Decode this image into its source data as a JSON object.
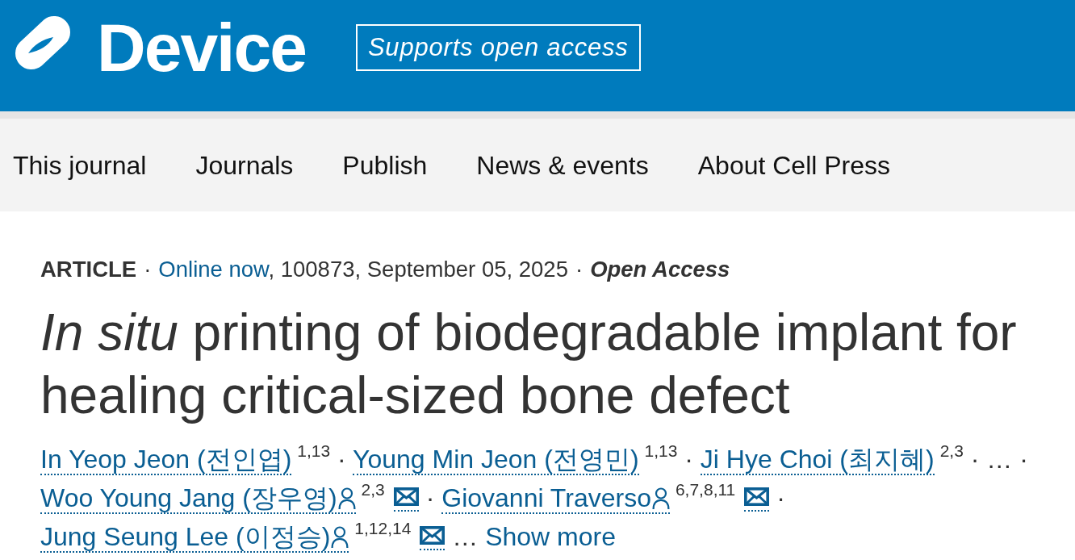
{
  "header": {
    "logo_text": "Device",
    "badge": "Supports open access"
  },
  "nav": {
    "items": [
      {
        "label": "This journal"
      },
      {
        "label": "Journals"
      },
      {
        "label": "Publish"
      },
      {
        "label": "News & events"
      },
      {
        "label": "About Cell Press"
      }
    ]
  },
  "article": {
    "meta": [
      {
        "kind": "type",
        "text": "ARTICLE"
      },
      {
        "kind": "separator",
        "text": "·"
      },
      {
        "kind": "status",
        "text": "Online now"
      },
      {
        "kind": "details",
        "text": ", 100873, September 05, 2025"
      },
      {
        "kind": "separator",
        "text": "·"
      },
      {
        "kind": "access",
        "text": "Open Access"
      }
    ],
    "title": "*In situ* printing of biodegradable implant for healing critical-sized bone defect",
    "authors": [
      {
        "kind": "author",
        "name": "In Yeop Jeon (전인엽)",
        "affiliations": "1,13",
        "corresponding": false,
        "separator": "·"
      },
      {
        "kind": "author",
        "name": "Young Min Jeon (전영민)",
        "affiliations": "1,13",
        "corresponding": false,
        "separator": "·"
      },
      {
        "kind": "author",
        "name": "Ji Hye Choi (최지혜)",
        "affiliations": "2,3",
        "corresponding": false,
        "separator": "·"
      },
      {
        "kind": "gap",
        "text": "…",
        "separator": "·"
      },
      {
        "kind": "author",
        "name": "Woo Young Jang (장우영)",
        "affiliations": "2,3",
        "corresponding": true,
        "separator": "·"
      },
      {
        "kind": "author",
        "name": "Giovanni Traverso",
        "affiliations": "6,7,8,11",
        "corresponding": true,
        "separator": "·"
      },
      {
        "kind": "author",
        "name": "Jung Seung Lee (이정승)",
        "affiliations": "1,12,14",
        "corresponding": true
      }
    ],
    "more_marker": "…",
    "show_more": "Show more"
  }
}
